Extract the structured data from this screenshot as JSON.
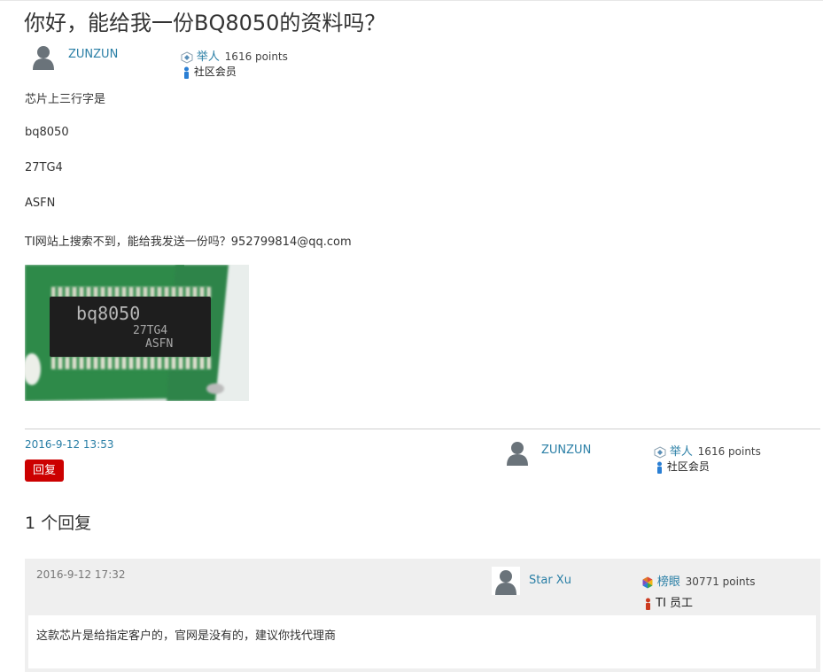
{
  "question": {
    "title": "你好，能给我一份BQ8050的资料吗？",
    "author": {
      "name": "ZUNZUN",
      "rank": "举人",
      "points": "1616 points",
      "role": "社区会员"
    },
    "body": [
      "芯片上三行字是",
      "bq8050",
      "27TG4",
      "ASFN",
      "TI网站上搜索不到，能给我发送一份吗？952799814@qq.com"
    ],
    "image": {
      "chip_lines": [
        "bq8050",
        "27TG4",
        "ASFN"
      ]
    },
    "date": "2016-9-12 13:53",
    "reply_button": "回复"
  },
  "replies_heading": "1 个回复",
  "replies": [
    {
      "date": "2016-9-12 17:32",
      "author": {
        "name": "Star Xu",
        "rank": "榜眼",
        "points": "30771 points",
        "role": "TI 员工"
      },
      "text": "这款芯片是给指定客户的，官网是没有的，建议你找代理商"
    }
  ],
  "colors": {
    "link": "#2a7fa6",
    "reply_button": "#cc0000",
    "community_badge": "#2a7fd4",
    "ti_badge": "#cc3a1f"
  }
}
